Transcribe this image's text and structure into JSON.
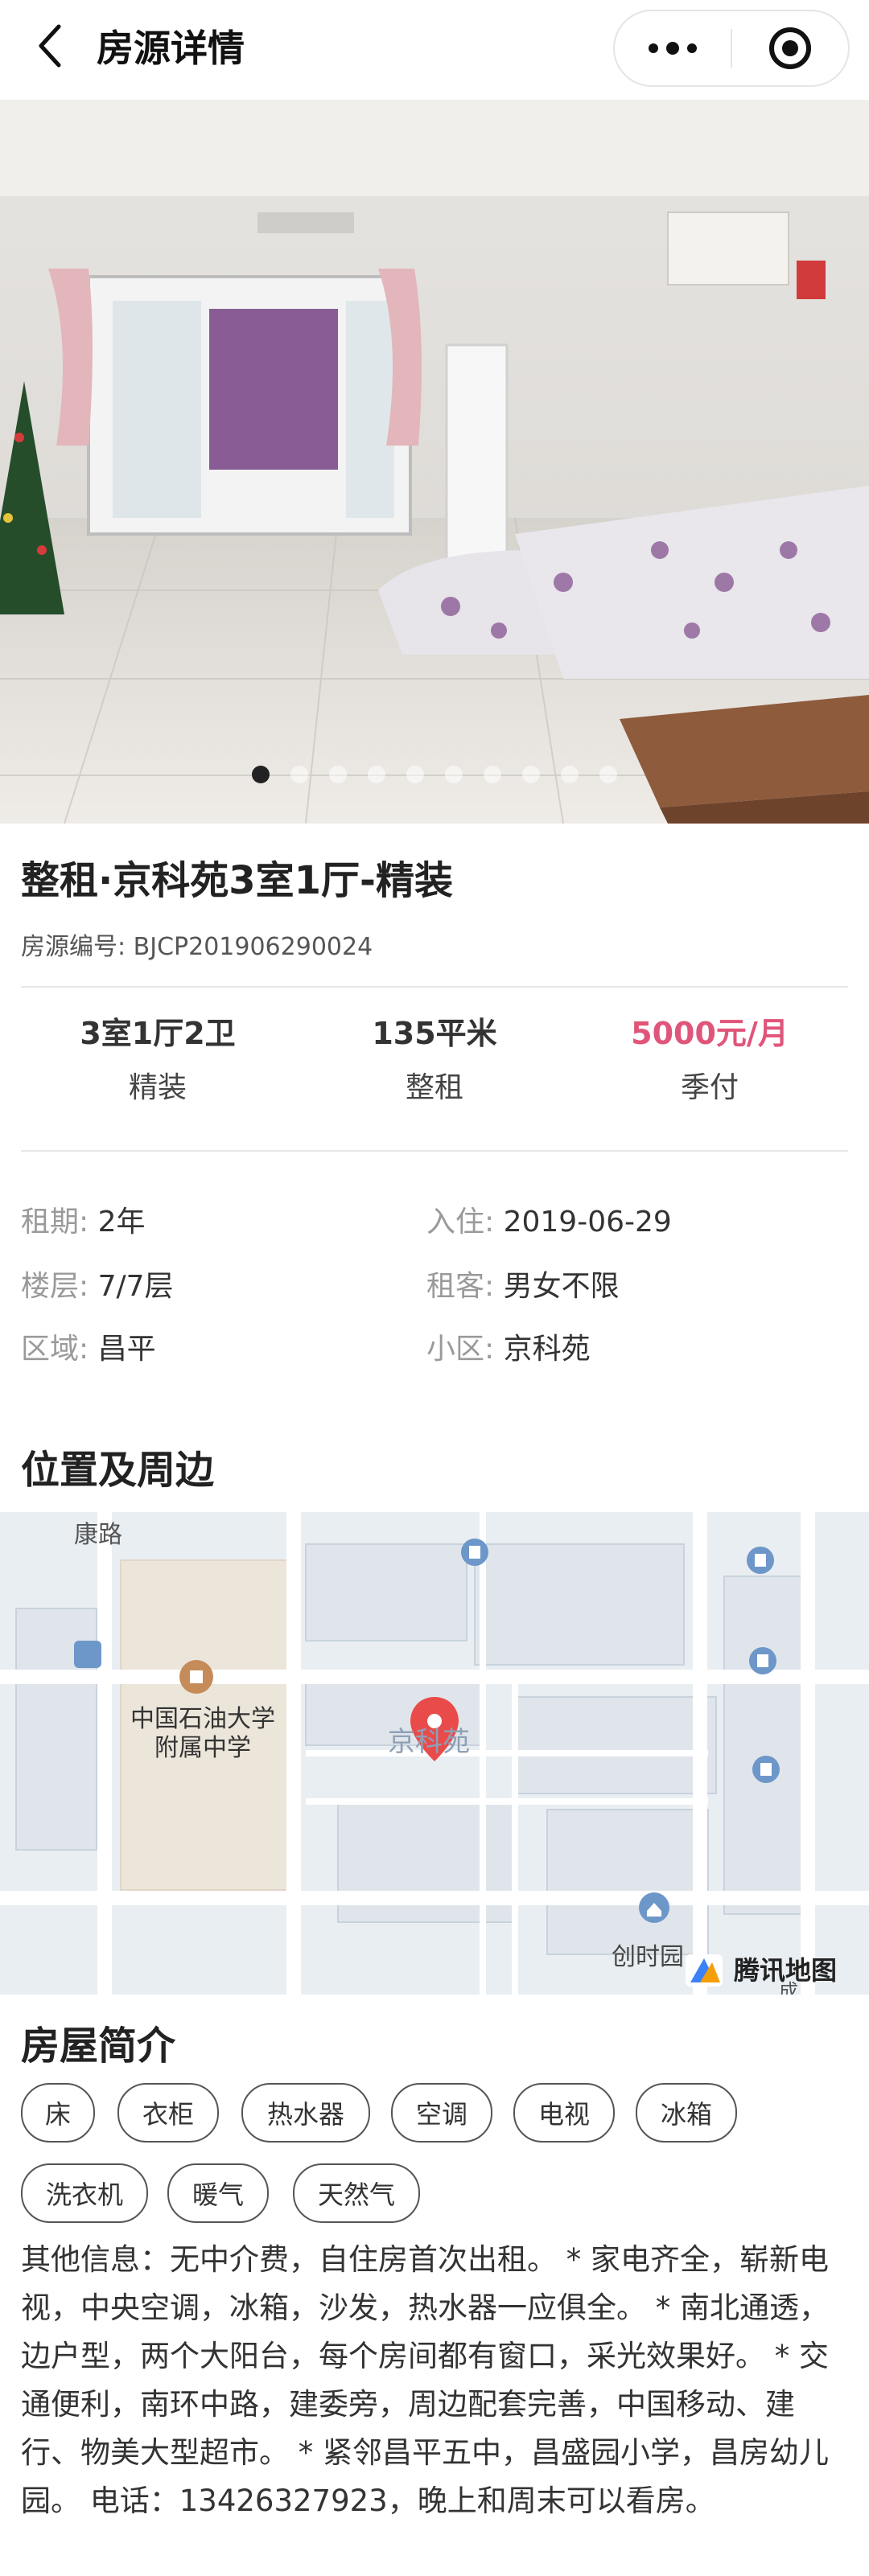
{
  "header": {
    "title": "房源详情",
    "icons": {
      "back": "back-arrow-icon",
      "more": "more-dots-icon",
      "target": "record-circle-icon"
    }
  },
  "gallery": {
    "images_count": 10,
    "active_index": 0
  },
  "listing": {
    "title": "整租·京科苑3室1厅-精装",
    "code_label": "房源编号: ",
    "code": "BJCP201906290024"
  },
  "stats": [
    {
      "value": "3室1厅2卫",
      "sub": "精装"
    },
    {
      "value": "135平米",
      "sub": "整租"
    },
    {
      "value": "5000元/月",
      "sub": "季付"
    }
  ],
  "details": {
    "term": {
      "label": "租期:",
      "value": "2年"
    },
    "movein": {
      "label": "入住:",
      "value": "2019-06-29"
    },
    "floor": {
      "label": "楼层:",
      "value": "7/7层"
    },
    "tenant": {
      "label": "租客:",
      "value": "男女不限"
    },
    "area": {
      "label": "区域:",
      "value": "昌平"
    },
    "community": {
      "label": "小区:",
      "value": "京科苑"
    }
  },
  "location": {
    "section_title": "位置及周边",
    "map_labels": {
      "road": "康路",
      "school": "中国石油大学附属中学",
      "school_line1": "中国石油大学",
      "school_line2": "附属中学",
      "pin": "京科苑",
      "poi_bottom": "创时园",
      "provider": "腾讯地图",
      "edge_char": "成"
    }
  },
  "intro": {
    "section_title": "房屋简介",
    "tags": [
      "床",
      "衣柜",
      "热水器",
      "空调",
      "电视",
      "冰箱",
      "洗衣机",
      "暖气",
      "天然气"
    ],
    "description": "其他信息：无中介费，自住房首次出租。 * 家电齐全，崭新电视，中央空调，冰箱，沙发，热水器一应俱全。 * 南北通透，边户型，两个大阳台，每个房间都有窗口，采光效果好。 * 交通便利，南环中路，建委旁，周边配套完善，中国移动、建行、物美大型超市。 * 紧邻昌平五中，昌盛园小学，昌房幼儿园。 电话：13426327923，晚上和周末可以看房。"
  },
  "colors": {
    "accent_price": "#e0557a",
    "map_bg": "#e9eef2",
    "pin": "#e94b4b"
  }
}
